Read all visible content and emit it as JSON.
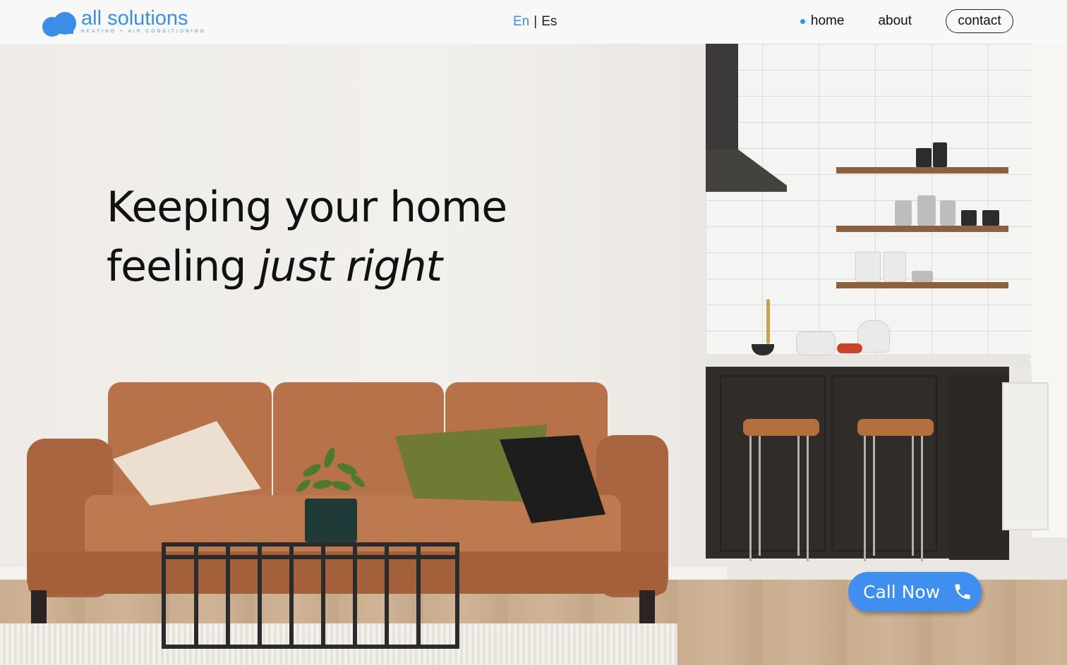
{
  "brand": {
    "name": "all solutions",
    "tagline": "HEATING + AIR CONDITIONING",
    "color": "#3b8ee8"
  },
  "language": {
    "active": "En",
    "separator": "|",
    "other": "Es"
  },
  "nav": {
    "home": "home",
    "about": "about",
    "contact": "contact",
    "active_item": "home"
  },
  "hero": {
    "line1": "Keeping your home",
    "line2_prefix": "feeling ",
    "line2_emphasis": "just right"
  },
  "cta": {
    "call_label": "Call Now",
    "icon": "phone-icon",
    "color": "#3f8ef0"
  },
  "scene": {
    "description_icon": "living-room-kitchen-photo"
  }
}
